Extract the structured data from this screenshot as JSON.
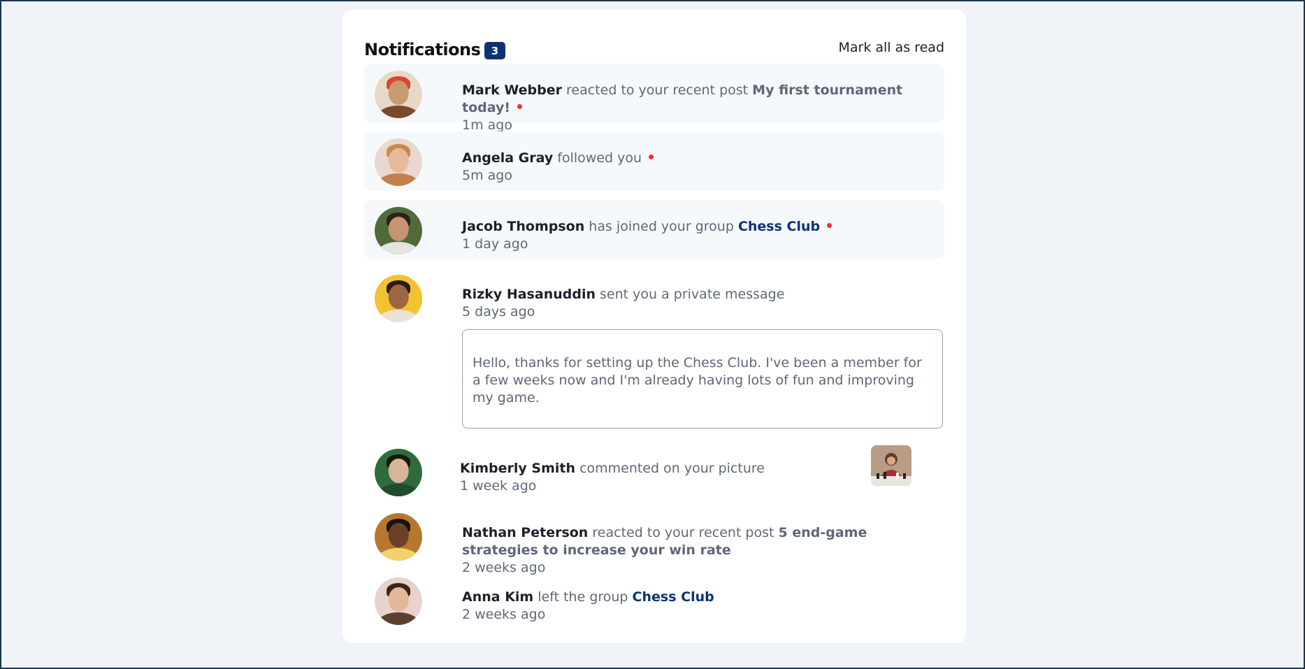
{
  "header": {
    "title": "Notifications",
    "unread_count": "3",
    "mark_all_label": "Mark all as read"
  },
  "notifications": [
    {
      "name": "Mark Webber",
      "action": "reacted to your recent post",
      "post": "My first tournament today!",
      "time": "1m ago",
      "unread": true,
      "avatar_icon": "avatar-mark-webber"
    },
    {
      "name": "Angela Gray",
      "action": "followed you",
      "time": "5m ago",
      "unread": true,
      "avatar_icon": "avatar-angela-gray"
    },
    {
      "name": "Jacob Thompson",
      "action": "has joined your group",
      "group": "Chess Club",
      "time": "1 day ago",
      "unread": true,
      "avatar_icon": "avatar-jacob-thompson"
    },
    {
      "name": "Rizky Hasanuddin",
      "action": "sent you a private message",
      "time": "5 days ago",
      "unread": false,
      "message": "Hello, thanks for setting up the Chess Club. I've been a member for a few weeks now and I'm already having lots of fun and improving my game.",
      "avatar_icon": "avatar-rizky-hasanuddin"
    },
    {
      "name": "Kimberly Smith",
      "action": "commented on your picture",
      "time": "1 week ago",
      "unread": false,
      "avatar_icon": "avatar-kimberly-smith",
      "picture_icon": "chess-picture-thumbnail"
    },
    {
      "name": "Nathan Peterson",
      "action": "reacted to your recent post",
      "post": "5 end-game strategies to increase your win rate",
      "time": "2 weeks ago",
      "unread": false,
      "avatar_icon": "avatar-nathan-peterson"
    },
    {
      "name": "Anna Kim",
      "action": "left the group",
      "group": "Chess Club",
      "time": "2 weeks ago",
      "unread": false,
      "avatar_icon": "avatar-anna-kim"
    }
  ],
  "colors": {
    "page_bg": "#f0f4f9",
    "card_bg": "#ffffff",
    "unread_bg": "#f6f9fc",
    "badge_bg": "#0b3374",
    "group_link": "#0b3374",
    "unread_dot": "#f52e2e"
  }
}
